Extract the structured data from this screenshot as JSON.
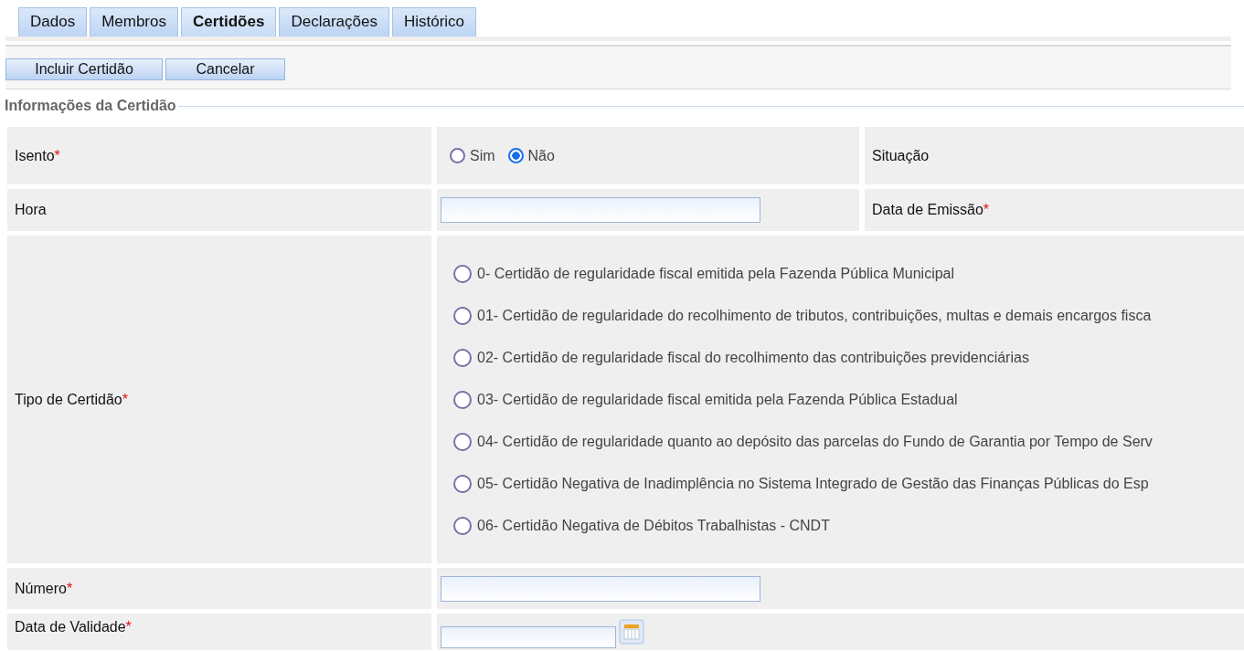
{
  "tabs": [
    {
      "label": "Dados",
      "selected": false
    },
    {
      "label": "Membros",
      "selected": false
    },
    {
      "label": "Certidões",
      "selected": true
    },
    {
      "label": "Declarações",
      "selected": false
    },
    {
      "label": "Histórico",
      "selected": false
    }
  ],
  "toolbar": {
    "buttons": [
      "Incluir Certidão",
      "Cancelar"
    ]
  },
  "section": {
    "legend": "Informações da Certidão"
  },
  "form": {
    "isento": {
      "label": "Isento",
      "required_mark": "*",
      "options": [
        {
          "label": "Sim",
          "selected": false
        },
        {
          "label": "Não",
          "selected": true
        }
      ]
    },
    "situacao": {
      "label": "Situação"
    },
    "hora": {
      "label": "Hora"
    },
    "data_emissao": {
      "label": "Data de Emissão",
      "required_mark": "*"
    },
    "tipo": {
      "label": "Tipo de Certidão",
      "required_mark": "*",
      "options": [
        {
          "label": "0- Certidão de regularidade fiscal emitida pela Fazenda Pública Municipal",
          "selected": false
        },
        {
          "label": "01- Certidão de regularidade do recolhimento de tributos, contribuições, multas e demais encargos fisca",
          "selected": false
        },
        {
          "label": "02- Certidão de regularidade fiscal do recolhimento das contribuições previdenciárias",
          "selected": false
        },
        {
          "label": "03- Certidão de regularidade fiscal emitida pela Fazenda Pública Estadual",
          "selected": false
        },
        {
          "label": "04- Certidão de regularidade quanto ao depósito das parcelas do Fundo de Garantia por Tempo de Serv",
          "selected": false
        },
        {
          "label": "05- Certidão Negativa de Inadimplência no Sistema Integrado de Gestão das Finanças Públicas do Esp",
          "selected": false
        },
        {
          "label": "06- Certidão Negativa de Débitos Trabalhistas - CNDT",
          "selected": false
        }
      ]
    },
    "numero": {
      "label": "Número",
      "required_mark": "*"
    },
    "data_validade": {
      "label": "Data de Validade",
      "required_mark": "*"
    }
  }
}
